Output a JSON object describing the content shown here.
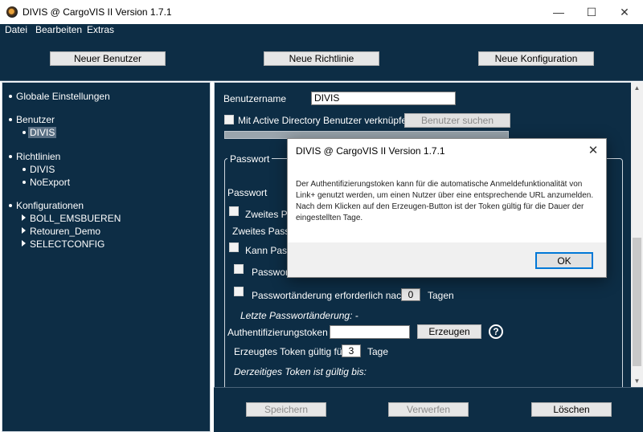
{
  "window": {
    "title": "DIVIS @ CargoVIS II Version 1.7.1",
    "minimize": "—",
    "maximize": "☐",
    "close": "✕"
  },
  "menu": [
    "Datei",
    "Bearbeiten",
    "Extras"
  ],
  "toolbar": {
    "new_user": "Neuer Benutzer",
    "new_policy": "Neue Richtlinie",
    "new_config": "Neue Konfiguration"
  },
  "tree": {
    "global": "Globale Einstellungen",
    "users": "Benutzer",
    "user_divis": "DIVIS",
    "policies": "Richtlinien",
    "policy_divis": "DIVIS",
    "policy_noexport": "NoExport",
    "configs": "Konfigurationen",
    "config_boll": "BOLL_EMSBUEREN",
    "config_retouren": "Retouren_Demo",
    "config_select": "SELECTCONFIG"
  },
  "form": {
    "username_label": "Benutzername",
    "username_value": "DIVIS",
    "ad_link_label": "Mit Active Directory Benutzer verknüpfen",
    "search_user_button": "Benutzer suchen",
    "password_group": "Passwort",
    "password_label": "Passwort",
    "second_pw_check": "Zweites Pa",
    "second_pw_label": "Zweites Passw",
    "can_pw_check": "Kann Passw",
    "pw_sub_check": "Passworta",
    "pw_change_required": "Passwortänderung erforderlich nach:",
    "pw_change_days": "0",
    "days_label": "Tagen",
    "last_pw_change": "Letzte Passwortänderung:  -",
    "auth_token_label": "Authentifizierungstoken",
    "auth_token_value": "",
    "generate_button": "Erzeugen",
    "help_icon": "?",
    "token_valid_for": "Erzeugtes Token gültig für:",
    "token_days": "3",
    "token_days_label": "Tage",
    "token_valid_until": "Derzeitiges Token ist gültig bis:"
  },
  "bottom": {
    "save": "Speichern",
    "discard": "Verwerfen",
    "delete": "Löschen"
  },
  "dialog": {
    "title": "DIVIS @ CargoVIS II Version 1.7.1",
    "close": "✕",
    "message": "Der Authentifizierungstoken kann für die automatische Anmeldefunktionalität von Link+ genutzt werden, um einen Nutzer über eine entsprechende URL anzumelden. Nach dem Klicken auf den Erzeugen-Button ist der Token gültig für die Dauer der eingestellten Tage.",
    "ok": "OK"
  },
  "colors": {
    "background": "#0d2d45",
    "accent": "#0078d7"
  }
}
